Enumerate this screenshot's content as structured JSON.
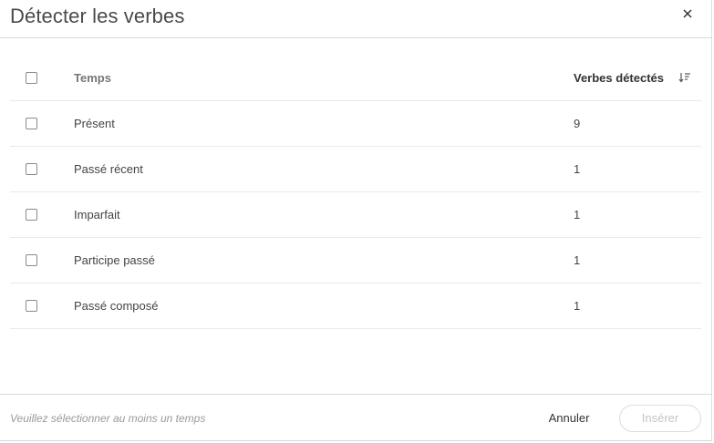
{
  "dialog": {
    "title": "Détecter les verbes"
  },
  "table": {
    "columns": {
      "temps": "Temps",
      "count": "Verbes détectés"
    },
    "sort_icon": "sort-descending-icon",
    "rows": [
      {
        "temps": "Présent",
        "count": "9",
        "checked": false
      },
      {
        "temps": "Passé récent",
        "count": "1",
        "checked": false
      },
      {
        "temps": "Imparfait",
        "count": "1",
        "checked": false
      },
      {
        "temps": "Participe passé",
        "count": "1",
        "checked": false
      },
      {
        "temps": "Passé composé",
        "count": "1",
        "checked": false
      }
    ]
  },
  "footer": {
    "hint": "Veuillez sélectionner au moins un temps",
    "cancel_label": "Annuler",
    "insert_label": "Insérer",
    "insert_disabled": true
  },
  "colors": {
    "title_text": "#4a4a4a",
    "divider": "#d9d9d9",
    "row_divider": "#e9e9e9",
    "disabled_text": "#c4c4c4",
    "hint_text": "#9a9a9a"
  }
}
